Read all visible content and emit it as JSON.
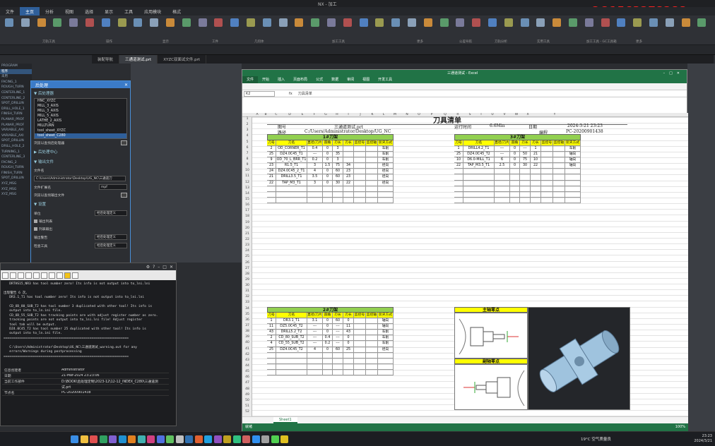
{
  "nx": {
    "title": "NX - 加工",
    "watermark": "QQ1563278288",
    "tabs": [
      "文件",
      "主页",
      "分析",
      "视图",
      "选择",
      "显示",
      "工具",
      "应用模块",
      "格式"
    ],
    "active_tab": "主页",
    "ribbon_groups": [
      "刀轨工具",
      "操作",
      "显示",
      "工件",
      "几何体",
      "加工工具",
      "更多",
      "公差导航",
      "刀轨分析",
      "实用工具",
      "加工工具 - GC工具箱",
      "更多"
    ],
    "file_tabs": [
      "装配导航",
      "三通道测试.prt",
      "XYZC双面试文件.prt"
    ],
    "active_file_tab": "三通道测试.prt"
  },
  "nav": {
    "rows": [
      "PROGRAM",
      "程序",
      "未用",
      "FACING_1",
      "ROUGH_TURN",
      "CENTERLINE_1",
      "CENTERLINE_2",
      "SPOT_DRILLIN",
      "DRILL_HOLE_1",
      "FINISH_TURN",
      "PLANAR_PROF",
      "PLANAR_PROF",
      "VARIABLE_AXI",
      "VARIABLE_AXI",
      "SPOT_DRILLIN",
      "DRILL_HOLE_2",
      "TURNING_1",
      "CENTERLINE_3",
      "FACING_2",
      "ROUGH_TURN",
      "FINISH_TURN",
      "SPOT_DRILLIN",
      "XYZ_MSG",
      "XYZ_MSG",
      "XYZ_MSG"
    ],
    "selected": "程序"
  },
  "postprocess": {
    "title": "后处理",
    "section_post": "后处理器",
    "posts": [
      "HNC_XYZC",
      "MILL_3_AXIS",
      "MILL_3_AXIS",
      "MILL_5_AXIS",
      "LATHE_2_AXIS",
      "MILLTURN",
      "tool_sheet_XYZC",
      "tool_sheet_C280"
    ],
    "selected_post": "tool_sheet_C280",
    "browse_label": "浏览以查找后处理器",
    "post_center": "后处理中心",
    "section_output": "输出文件",
    "filename_label": "文件名",
    "filename_value": "C:\\Users\\Administrator\\Desktop\\UG_NC\\三通道刀",
    "ext_label": "文件扩展名",
    "ext_value": "mpf",
    "browse_output_label": "浏览以查找输出文件",
    "section_settings": "设置",
    "unit_label": "单位",
    "unit_value": "经后处理定义",
    "list_output_label": "输出列表",
    "list_output_checked": true,
    "output_warning_label": "列表输出",
    "output_warning_checked": true,
    "warning_label": "输出警告",
    "warning_value": "经后处理定义",
    "check_tool_label": "检查工具",
    "check_tool_value": "经后处理定义"
  },
  "info_window": {
    "text_lines": [
      "   DRTHS15_NR3 has tool number zero! Its info is not output into to_lni.lni",
      "",
      "出现警告 6 次。",
      "   DR3.1_T1 has tool number zero! Its info is not output into to_lni.lni",
      "",
      "   CD_OD_80_SUB_T2 has tool number 3 duplicated with other tool! Its info is",
      "   output into to_ln.ini file.",
      "   CD_OD_55_SUB_T2 has tracking points are with adjust register number as zero.",
      "   tracking points are not output into to_lni.lni file! Adjust register",
      "   tool tab will be output.",
      "   DZ4.0C45_T2 has tool number 25 duplicated with other tool! Its info is",
      "   output into to_ln.ini file.",
      "================================================================",
      "",
      "   C:\\Users\\Administrator\\Desktop\\UG_NC\\三通道测试_warning.out for any",
      "   errors/Warnings during postprocessing",
      "================================================================"
    ],
    "table": [
      {
        "k": "信息创建者",
        "v": "Administrator"
      },
      {
        "k": "日期",
        "v": "21-Mar-2024 23:23:06"
      },
      {
        "k": "当前工作部件",
        "v": "D:\\BOOK\\后处理定制\\2023-12\\12-12_INDEX_C280\\三通道测"
      },
      {
        "k": "",
        "v": "试.prt"
      },
      {
        "k": "节点名",
        "v": "PC-20200901438"
      }
    ]
  },
  "excel": {
    "title": "三通道测试 - Excel",
    "menu": [
      "文件",
      "开始",
      "插入",
      "页面布局",
      "公式",
      "数据",
      "审阅",
      "视图",
      "开发工具"
    ],
    "namebox": "K2",
    "formula_value": "刀具清单",
    "col_letters": [
      "A",
      "B",
      "C",
      "D",
      "E",
      "F",
      "G",
      "H",
      "I",
      "J",
      "K",
      "L",
      "M",
      "N",
      "O",
      "P",
      "Q",
      "R",
      "S",
      "T",
      "U",
      "V",
      "W",
      "X",
      "Y"
    ],
    "sheet_title": "刀具清单",
    "part_label": "图号",
    "part_value": "三通道测试.prt",
    "runtime_label": "运行时间",
    "runtime_value": "6.6Min",
    "date_label": "日期",
    "date_value": "2024-3-21 23:23",
    "path_label": "路径",
    "path_value": "C:/Users/Administrator/Desktop/UG_NC",
    "pc_label": "编程",
    "pc_value": "PC-20200901438",
    "col_headers": [
      "刀号",
      "刀名",
      "直径/刀片",
      "圆角",
      "刃长",
      "刃长",
      "监控号",
      "监控轴",
      "装夹方式"
    ],
    "turret1_title": "1#刀架",
    "turret1_rows": [
      [
        "2",
        "OD_CORNER_T1",
        "0.4",
        "0",
        "3",
        "",
        "",
        "",
        "车削"
      ],
      [
        "25",
        "DZ4.0C45_T1",
        "---",
        "0",
        "35",
        "",
        "",
        "",
        "车削"
      ],
      [
        "9",
        "OD_70_L_BRR_T1",
        "0.2",
        "0",
        "3",
        "",
        "",
        "",
        "车削"
      ],
      [
        "23",
        "R1.5_T1",
        "3",
        "1.5",
        "75",
        "34",
        "",
        "",
        "径向"
      ],
      [
        "24",
        "DZ4.0C45_2_T1",
        "4",
        "0",
        "60",
        "23",
        "",
        "",
        "径向"
      ],
      [
        "21",
        "DRILL3.5_T1",
        "3.5",
        "0",
        "60",
        "23",
        "",
        "",
        "径向"
      ],
      [
        "22",
        "TAP_M3_T1",
        "3",
        "0",
        "30",
        "22",
        "",
        "",
        "径向"
      ]
    ],
    "turret3_title": "3#刀架",
    "turret3_rows": [
      [
        "1",
        "DRILL4.2_T1",
        "---",
        "0",
        "---",
        "1",
        "",
        "",
        "车削"
      ],
      [
        "25",
        "DZ4.0C45_T2",
        "---",
        "0",
        "50",
        "21",
        "",
        "",
        "轴向"
      ],
      [
        "10",
        "D6.0-MILL_T1",
        "6",
        "0",
        "75",
        "10",
        "",
        "",
        "轴向"
      ],
      [
        "22",
        "TAP_M3.5_T1",
        "2.5",
        "0",
        "30",
        "22",
        "",
        "",
        "轴向"
      ]
    ],
    "turret2_title": "2#刀架",
    "turret2_rows": [
      [
        "1",
        "DR3.1_T1",
        "3.1",
        "0",
        "60",
        "0",
        "",
        "",
        "轴向"
      ],
      [
        "11",
        "DZ5.0C45_T2",
        "---",
        "0",
        "---",
        "11",
        "",
        "",
        "轴向"
      ],
      [
        "43",
        "DRILL5.2_T2",
        "---",
        "0",
        "---",
        "43",
        "",
        "",
        "车削"
      ],
      [
        "2",
        "CD_80_SUB_T2",
        "---",
        "0.4",
        "---",
        "0",
        "",
        "",
        "车削"
      ],
      [
        "4",
        "CD_55_SUB_T2",
        "---",
        "0.2",
        "---",
        "0",
        "",
        "",
        "车削"
      ],
      [
        "25",
        "DZ4.0C45_T2",
        "4",
        "0",
        "60",
        "25",
        "",
        "",
        "径向"
      ]
    ],
    "main_spindle_label": "主轴零点",
    "sub_spindle_label": "副轴零点",
    "sheet_tab": "Sheet1",
    "status_left": "就绪",
    "zoom": "100%"
  },
  "taskbar": {
    "weather": "19°C 空气质量良",
    "time": "23:23",
    "date": "2024/3/21"
  }
}
